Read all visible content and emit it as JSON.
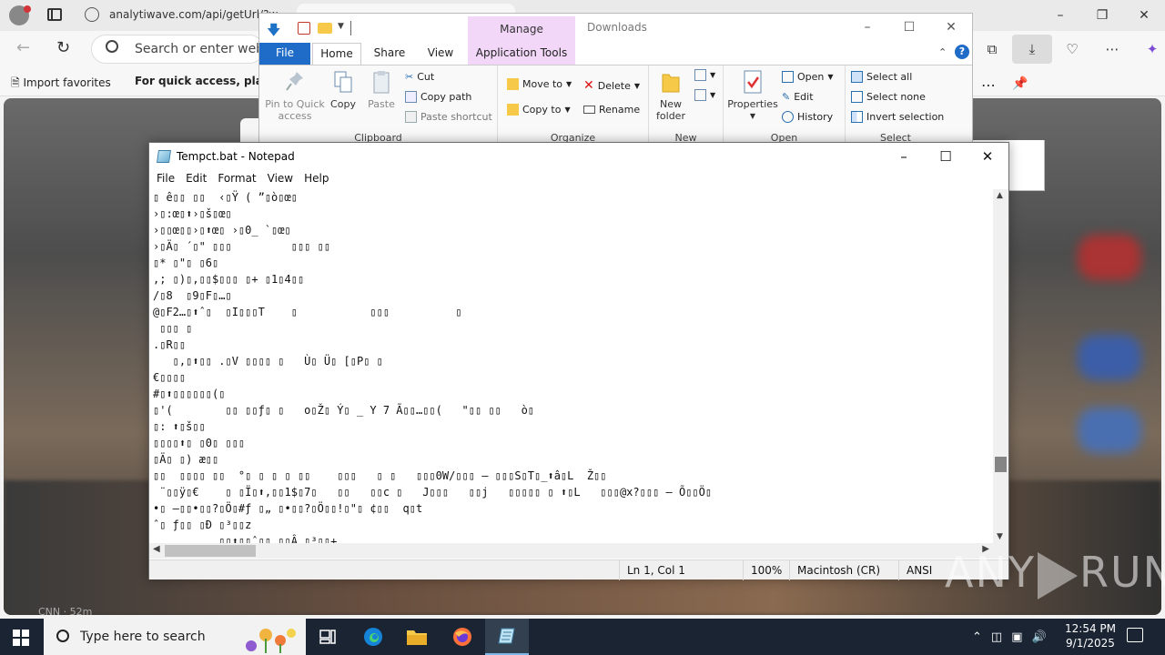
{
  "browser": {
    "url": "analytiwave.com/api/getUrl/?w",
    "search_placeholder": "Search or enter web a",
    "import_favorites": "Import favorites",
    "quick_access_text": "For quick access, place yo",
    "feed_source": "CNN · 52m"
  },
  "explorer": {
    "title": "Downloads",
    "manage_label": "Manage",
    "tabs": {
      "file": "File",
      "home": "Home",
      "share": "Share",
      "view": "View",
      "app_tools": "Application Tools"
    },
    "clipboard": {
      "label": "Clipboard",
      "pin": "Pin to Quick access",
      "copy": "Copy",
      "paste": "Paste",
      "cut": "Cut",
      "copy_path": "Copy path",
      "paste_shortcut": "Paste shortcut"
    },
    "organize": {
      "label": "Organize",
      "move_to": "Move to",
      "copy_to": "Copy to",
      "delete": "Delete",
      "rename": "Rename"
    },
    "new": {
      "label": "New",
      "new_folder": "New folder"
    },
    "open": {
      "label": "Open",
      "properties": "Properties",
      "open": "Open",
      "edit": "Edit",
      "history": "History"
    },
    "select": {
      "label": "Select",
      "select_all": "Select all",
      "select_none": "Select none",
      "invert": "Invert selection"
    }
  },
  "notepad": {
    "title": "Tempct.bat - Notepad",
    "menu": [
      "File",
      "Edit",
      "Format",
      "View",
      "Help"
    ],
    "lines": [
      "▯ ê▯▯ ▯▯  ‹▯Ÿ ( ”▯ò▯œ▯",
      "›▯:œ▯⬆›▯š▯œ▯",
      "›▯▯œ▯▯›▯⬆œ▯ ›▯0_ `▯œ▯",
      "›▯Ä▯ ´▯\" ▯▯▯         ▯▯▯ ▯▯",
      "▯* ▯\"▯ ▯6▯",
      ",; ▯)▯,▯▯$▯▯▯ ▯+ ▯1▯4▯▯",
      "/▯8  ▯9▯F▯…▯",
      "@▯F2…▯⬆ˆ▯  ▯I▯▯▯T    ▯           ▯▯▯          ▯",
      " ▯▯▯ ▯",
      ".▯R▯▯",
      "   ▯,▯⬆▯▯ .▯V ▯▯▯▯ ▯   Ù▯ Ü▯ [▯P▯ ▯",
      "€▯▯▯▯",
      "#▯⬆▯▯▯▯▯▯(▯",
      "▯'(        ▯▯ ▯▯ƒ▯ ▯   o▯Ž▯ Ý▯ _ Y 7 Ã▯▯…▯▯(   \"▯▯ ▯▯   ò▯",
      "▯: ⬆▯š▯▯",
      "▯▯▯▯⬆▯ ▯0▯ ▯▯▯",
      "▯Ä▯ ▯) æ▯▯",
      "▯▯  ▯▯▯▯ ▯▯  °▯ ▯ ▯ ▯ ▯▯    ▯▯▯   ▯ ▯   ▯▯▯0W/▯▯▯ – ▯▯▯S▯T▯_⬆â▯L  Ž▯▯",
      " ¨▯▯ÿ▯€    ▯ ▯Ï▯⬆,▯▯1$▯7▯   ▯▯   ▯▯c ▯   J▯▯▯   ▯▯j   ▯▯▯▯▯ ▯ ⬆▯L   ▯▯▯@x?▯▯▯ – Õ▯▯Ö▯",
      "•▯ –▯▯•▯▯?▯Ö▯#ƒ ▯„ ▯•▯▯?▯Ö▯▯!▯\"▯ ¢▯▯  q▯t",
      "ˆ▯ ƒ▯▯ ▯Ð ▯³▯▯z",
      "          ▯▯⬆▯▯ˆ▯▯ ▯▯Â ▯³▯▯+"
    ],
    "status": {
      "position": "Ln 1, Col 1",
      "zoom": "100%",
      "line_ending": "Macintosh (CR)",
      "encoding": "ANSI"
    }
  },
  "taskbar": {
    "search_placeholder": "Type here to search",
    "time": "12:54 PM",
    "date": "9/1/2025"
  },
  "watermark": {
    "left": "ANY",
    "right": "RUN"
  }
}
